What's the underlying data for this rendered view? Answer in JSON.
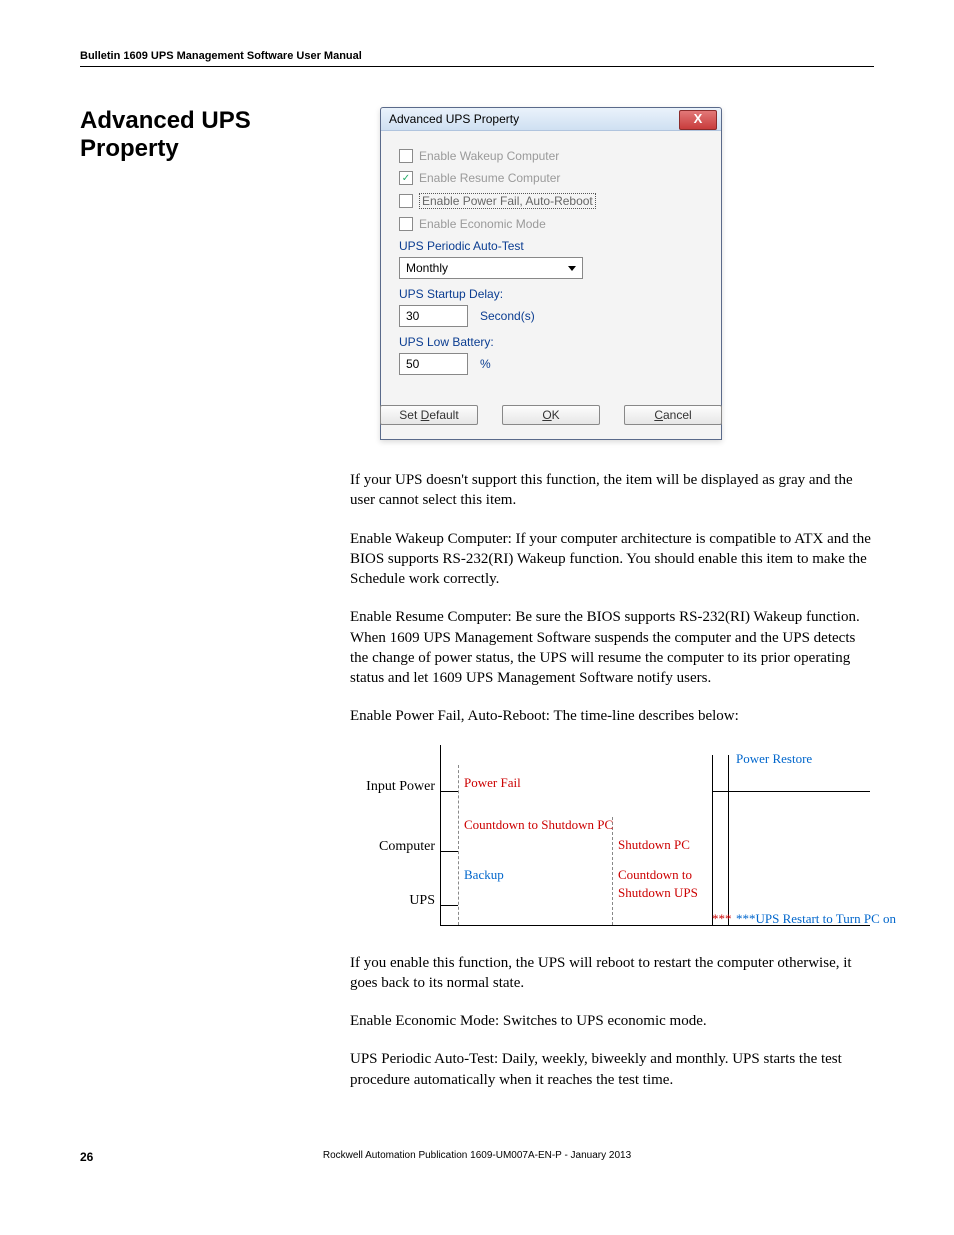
{
  "header": {
    "running": "Bulletin 1609 UPS Management Software User Manual"
  },
  "section": {
    "title": "Advanced UPS Property"
  },
  "dialog": {
    "title": "Advanced UPS Property",
    "close_glyph": "X",
    "checks": {
      "wakeup": "Enable Wakeup Computer",
      "resume": "Enable Resume Computer",
      "powerfail": "Enable Power Fail, Auto-Reboot",
      "economic": "Enable Economic Mode"
    },
    "labels": {
      "autotest": "UPS Periodic Auto-Test",
      "startup_delay": "UPS Startup Delay:",
      "low_battery": "UPS Low Battery:"
    },
    "values": {
      "autotest": "Monthly",
      "startup_delay": "30",
      "startup_unit": "Second(s)",
      "low_battery": "50",
      "low_battery_unit": "%"
    },
    "buttons": {
      "set_default_pre": "Set ",
      "set_default_u": "D",
      "set_default_post": "efault",
      "ok_u": "O",
      "ok_post": "K",
      "cancel_u": "C",
      "cancel_post": "ancel"
    }
  },
  "paras": {
    "p1": "If your UPS doesn't support this function, the item will be displayed as gray and the user cannot select this item.",
    "p2": "Enable Wakeup Computer: If your computer architecture is compatible to ATX and the BIOS supports RS-232(RI) Wakeup function. You should enable this item to make the Schedule work correctly.",
    "p3": "Enable Resume Computer: Be sure the BIOS supports RS-232(RI) Wakeup function. When 1609 UPS Management Software suspends the computer and the UPS detects the change of power status, the UPS will resume the computer to its prior operating status and let 1609 UPS Management Software notify users.",
    "p4": "Enable Power Fail, Auto-Reboot: The time-line describes below:",
    "p5": "If you enable this function, the UPS will reboot to restart the computer otherwise, it goes back to its normal state.",
    "p6": "Enable Economic Mode: Switches to UPS economic mode.",
    "p7": "UPS Periodic Auto-Test: Daily, weekly, biweekly and monthly. UPS starts the test procedure automatically when it reaches the test time."
  },
  "timeline": {
    "rows": {
      "input": "Input Power",
      "computer": "Computer",
      "ups": "UPS"
    },
    "labels": {
      "power_fail": "Power Fail",
      "power_restore": "Power Restore",
      "countdown_pc": "Countdown to Shutdown PC",
      "shutdown_pc": "Shutdown PC",
      "backup": "Backup",
      "countdown_to": "Countdown to",
      "shutdown_ups": "Shutdown UPS",
      "restart_note": "***UPS Restart to Turn PC on",
      "stars": "***"
    }
  },
  "footer": {
    "page": "26",
    "pub": "Rockwell Automation Publication 1609-UM007A-EN-P - January 2013"
  }
}
